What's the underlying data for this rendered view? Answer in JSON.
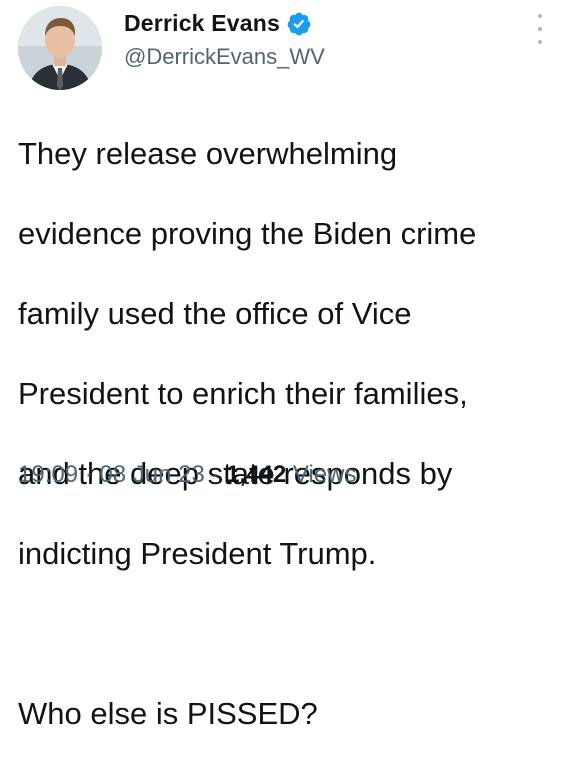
{
  "author": {
    "display_name": "Derrick Evans",
    "handle": "@DerrickEvans_WV",
    "verified": true,
    "avatar_icon": "profile-photo"
  },
  "tweet": {
    "lines": [
      "They release overwhelming",
      "evidence proving the Biden crime",
      "family used the office of Vice",
      "President to enrich their families,",
      "and the deep state responds by",
      "indicting President Trump."
    ],
    "closing": "Who else is PISSED?"
  },
  "meta": {
    "time": "19:09",
    "separator": "·",
    "date": "08 Jun 23",
    "views_count": "1,442",
    "views_label": "Views"
  },
  "colors": {
    "text": "#0f1419",
    "secondary": "#536471",
    "verified": "#1d9bf0"
  },
  "icons": {
    "more": "more-vertical-icon",
    "verified": "verified-badge-icon"
  }
}
